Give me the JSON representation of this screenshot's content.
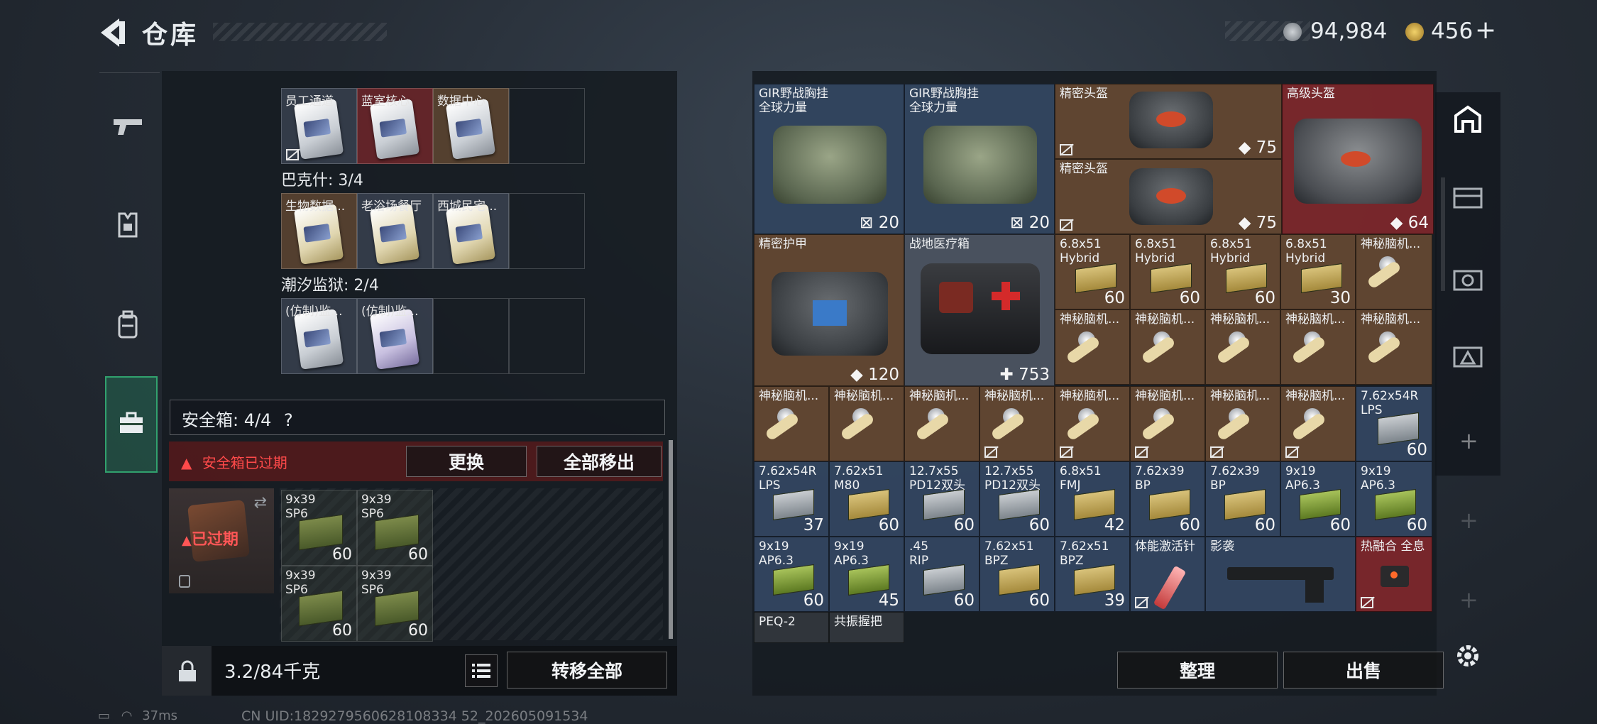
{
  "header": {
    "title": "仓库",
    "coin1": "94,984",
    "coin2": "456",
    "coin2_plus": "+"
  },
  "left_panel": {
    "rows": [
      {
        "slots": [
          "员工通道",
          "蓝室核心",
          "数据中心",
          ""
        ]
      },
      {
        "heading": "巴克什: 3/4",
        "slots": [
          "生物数据...",
          "老浴场餐厅",
          "西城民宅...",
          ""
        ]
      },
      {
        "heading": "潮汐监狱: 2/4",
        "slots": [
          "(仿制)监...",
          "(仿制)监...",
          "",
          ""
        ]
      }
    ],
    "safebox": {
      "label": "安全箱: 4/4",
      "help": "?",
      "expired_text": "安全箱已过期",
      "replace_button": "更换",
      "move_all_button": "全部移出",
      "expired_badge": "已过期"
    },
    "safebox_items": [
      {
        "label": "9x39\nSP6",
        "count": "60"
      },
      {
        "label": "9x39\nSP6",
        "count": "60"
      },
      {
        "label": "9x39\nSP6",
        "count": "60"
      },
      {
        "label": "9x39\nSP6",
        "count": "60"
      }
    ],
    "weight": "3.2/84千克",
    "transfer_all": "转移全部"
  },
  "stash": {
    "big_items": [
      {
        "label": "GIR野战胸挂\n全球力量",
        "value": "20"
      },
      {
        "label": "GIR野战胸挂\n全球力量",
        "value": "20"
      },
      {
        "label": "精密头盔",
        "value": "75"
      },
      {
        "label": "精密头盔",
        "value": "75"
      },
      {
        "label": "高级头盔",
        "value": "64"
      },
      {
        "label": "精密护甲",
        "value": "120"
      },
      {
        "label": "战地医疗箱",
        "value": "753"
      }
    ],
    "ammo_row1": [
      {
        "label": "6.8x51\nHybrid",
        "count": "60"
      },
      {
        "label": "6.8x51\nHybrid",
        "count": "60"
      },
      {
        "label": "6.8x51\nHybrid",
        "count": "60"
      },
      {
        "label": "6.8x51\nHybrid",
        "count": "30"
      }
    ],
    "mystery_label": "神秘脑机...",
    "row4": [
      {
        "label": "7.62x54R\nLPS",
        "count": "37"
      },
      {
        "label": "7.62x51\nM80",
        "count": "60"
      },
      {
        "label": "12.7x55\nPD12双头",
        "count": "60"
      },
      {
        "label": "12.7x55\nPD12双头",
        "count": "60"
      },
      {
        "label": "6.8x51\nFMJ",
        "count": "42"
      },
      {
        "label": "7.62x39\nBP",
        "count": "60"
      },
      {
        "label": "7.62x39\nBP",
        "count": "60"
      },
      {
        "label": "9x19\nAP6.3",
        "count": "60"
      },
      {
        "label": "9x19\nAP6.3",
        "count": "60"
      }
    ],
    "row3_last": {
      "label": "7.62x54R\nLPS",
      "count": "60"
    },
    "row5": [
      {
        "label": "9x19\nAP6.3",
        "count": "60"
      },
      {
        "label": "9x19\nAP6.3",
        "count": "45"
      },
      {
        "label": ".45\nRIP",
        "count": "60"
      },
      {
        "label": "7.62x51\nBPZ",
        "count": "60"
      },
      {
        "label": "7.62x51\nBPZ",
        "count": "39"
      },
      {
        "label": "体能激活针",
        "count": ""
      },
      {
        "label": "影袭",
        "count": ""
      },
      {
        "label": "热融合 全息",
        "count": ""
      }
    ],
    "row6": [
      {
        "label": "PEQ-2"
      },
      {
        "label": "共振握把"
      }
    ],
    "organize_button": "整理",
    "sell_button": "出售"
  },
  "status": {
    "ping": "37ms",
    "uid": "CN UID:1829279560628108334 52_202605091534"
  },
  "colors": {
    "expired_red": "#ff4a4a",
    "safe_green": "#3cdc8c"
  }
}
